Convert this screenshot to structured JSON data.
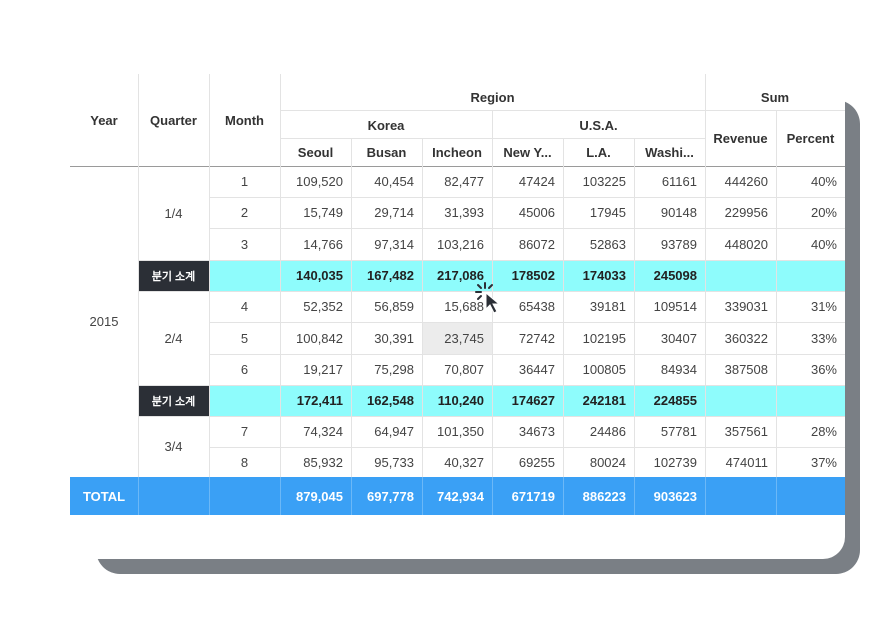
{
  "header": {
    "year": "Year",
    "quarter": "Quarter",
    "month": "Month",
    "region": "Region",
    "sum": "Sum",
    "korea": "Korea",
    "usa": "U.S.A.",
    "revenue": "Revenue",
    "percent": "Percent",
    "cities": [
      "Seoul",
      "Busan",
      "Incheon",
      "New Y...",
      "L.A.",
      "Washi..."
    ]
  },
  "year": "2015",
  "quarters": [
    "1/4",
    "2/4",
    "3/4"
  ],
  "rows": [
    {
      "month": "1",
      "values": [
        "109,520",
        "40,454",
        "82,477",
        "47424",
        "103225",
        "61161"
      ],
      "revenue": "444260",
      "percent": "40%"
    },
    {
      "month": "2",
      "values": [
        "15,749",
        "29,714",
        "31,393",
        "45006",
        "17945",
        "90148"
      ],
      "revenue": "229956",
      "percent": "20%"
    },
    {
      "month": "3",
      "values": [
        "14,766",
        "97,314",
        "103,216",
        "86072",
        "52863",
        "93789"
      ],
      "revenue": "448020",
      "percent": "40%"
    },
    {
      "month": "4",
      "values": [
        "52,352",
        "56,859",
        "15,688",
        "65438",
        "39181",
        "109514"
      ],
      "revenue": "339031",
      "percent": "31%"
    },
    {
      "month": "5",
      "values": [
        "100,842",
        "30,391",
        "23,745",
        "72742",
        "102195",
        "30407"
      ],
      "revenue": "360322",
      "percent": "33%"
    },
    {
      "month": "6",
      "values": [
        "19,217",
        "75,298",
        "70,807",
        "36447",
        "100805",
        "84934"
      ],
      "revenue": "387508",
      "percent": "36%"
    },
    {
      "month": "7",
      "values": [
        "74,324",
        "64,947",
        "101,350",
        "34673",
        "24486",
        "57781"
      ],
      "revenue": "357561",
      "percent": "28%"
    },
    {
      "month": "8",
      "values": [
        "85,932",
        "95,733",
        "40,327",
        "69255",
        "80024",
        "102739"
      ],
      "revenue": "474011",
      "percent": "37%"
    }
  ],
  "subtotals": [
    {
      "label": "분기 소계",
      "values": [
        "140,035",
        "167,482",
        "217,086",
        "178502",
        "174033",
        "245098"
      ]
    },
    {
      "label": "분기 소계",
      "values": [
        "172,411",
        "162,548",
        "110,240",
        "174627",
        "242181",
        "224855"
      ]
    }
  ],
  "total": {
    "label": "TOTAL",
    "values": [
      "879,045",
      "697,778",
      "742,934",
      "671719",
      "886223",
      "903623"
    ]
  },
  "colors": {
    "subtotal_row": "#8efcfc",
    "subtotal_label": "#2b2f36",
    "total_row": "#3aa0f5",
    "selected_cell": "#ececec"
  }
}
